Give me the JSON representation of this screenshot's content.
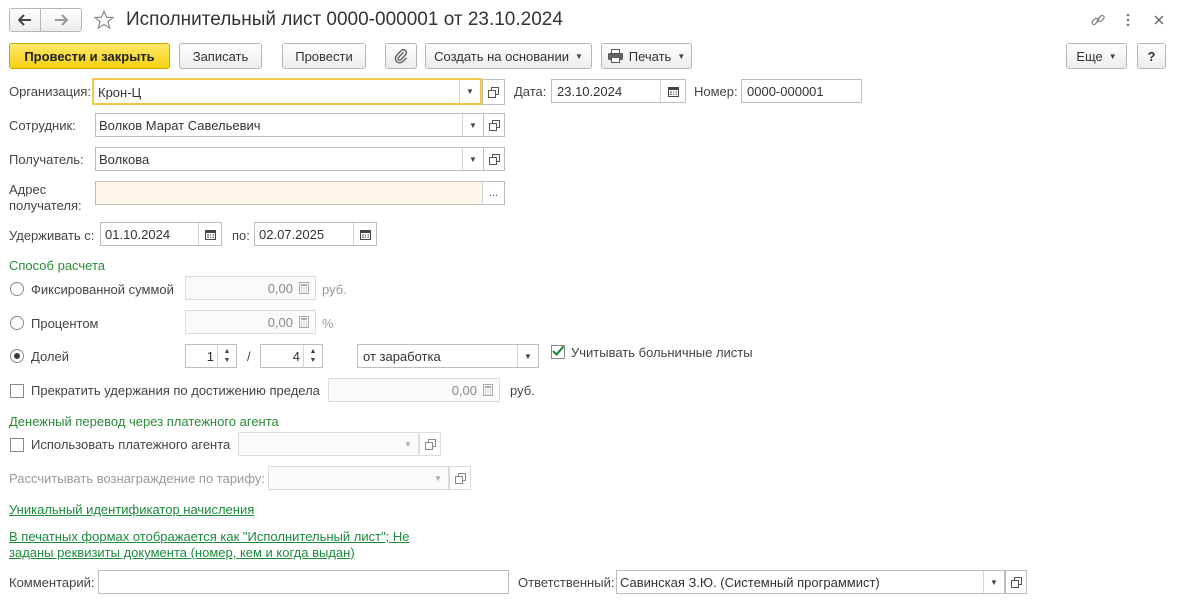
{
  "window": {
    "title": "Исполнительный лист 0000-000001 от 23.10.2024"
  },
  "toolbar": {
    "post_close": "Провести и закрыть",
    "save": "Записать",
    "post": "Провести",
    "create_based": "Создать на основании",
    "print": "Печать",
    "more": "Еще",
    "help": "?"
  },
  "form": {
    "org": {
      "label": "Организация:",
      "value": "Крон-Ц"
    },
    "date": {
      "label": "Дата:",
      "value": "23.10.2024"
    },
    "number": {
      "label": "Номер:",
      "value": "0000-000001"
    },
    "employee": {
      "label": "Сотрудник:",
      "value": "Волков Марат Савельевич"
    },
    "recipient": {
      "label": "Получатель:",
      "value": "Волкова"
    },
    "address": {
      "label_line1": "Адрес",
      "label_line2": "получателя:",
      "value": "",
      "button": "..."
    },
    "withhold": {
      "from_label": "Удерживать с:",
      "from_value": "01.10.2024",
      "to_label": "по:",
      "to_value": "02.07.2025"
    }
  },
  "calc": {
    "section": "Способ расчета",
    "fixed": {
      "label": "Фиксированной суммой",
      "value": "0,00",
      "unit": "руб."
    },
    "percent": {
      "label": "Процентом",
      "value": "0,00",
      "unit": "%"
    },
    "share": {
      "label": "Долей",
      "numerator": "1",
      "slash": "/",
      "denominator": "4",
      "base": "от заработка"
    },
    "sick_leave": {
      "label": "Учитывать больничные листы",
      "checked": true
    },
    "stop_limit": {
      "label": "Прекратить удержания по достижению предела",
      "value": "0,00",
      "unit": "руб."
    }
  },
  "transfer": {
    "section": "Денежный перевод через платежного агента",
    "use_agent": {
      "label": "Использовать платежного агента"
    },
    "fee": {
      "label": "Рассчитывать вознаграждение по тарифу:"
    }
  },
  "links": {
    "uid": "Уникальный идентификатор начисления",
    "print_line1": "В печатных формах отображается как \"Исполнительный лист\"; Не",
    "print_line2": "заданы реквизиты документа (номер, кем и когда выдан)"
  },
  "footer": {
    "comment_label": "Комментарий:",
    "comment_value": "",
    "responsible_label": "Ответственный:",
    "responsible_value": "Савинская З.Ю. (Системный программист)"
  },
  "colors": {
    "accent_yellow": "#f5d10f",
    "link_green": "#1d8a3b",
    "section_green": "#2a8a3a"
  }
}
